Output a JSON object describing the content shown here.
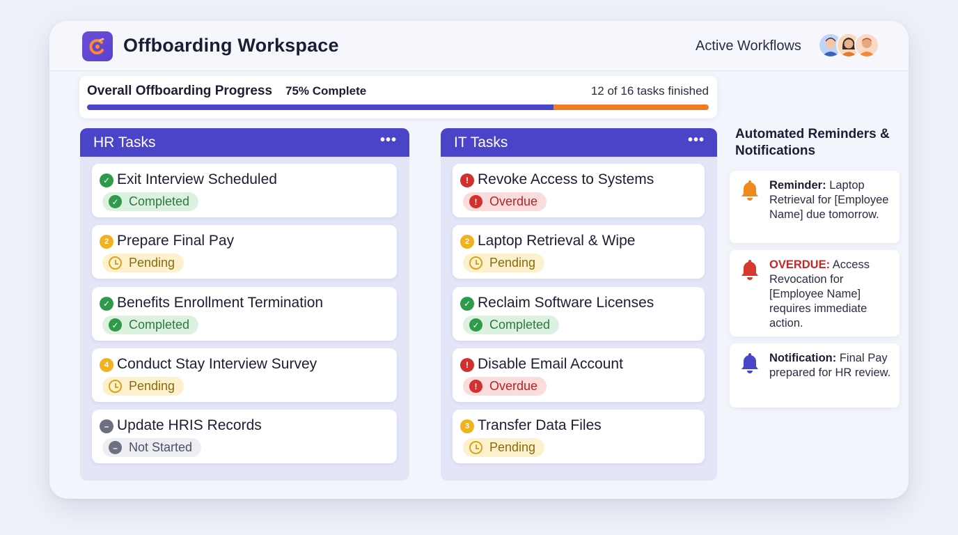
{
  "header": {
    "title": "Offboarding Workspace",
    "active_workflows_label": "Active Workflows",
    "avatars": [
      "avatar-1",
      "avatar-2",
      "avatar-3"
    ]
  },
  "progress": {
    "title": "Overall Offboarding Progress",
    "percent_label": "75% Complete",
    "count_label": "12 of 16 tasks finished",
    "fraction": 0.75
  },
  "columns": [
    {
      "title": "HR Tasks",
      "menu": "•••",
      "tasks": [
        {
          "name": "Exit Interview Scheduled",
          "status": "Completed",
          "icon": "check-icon",
          "marker": "✓"
        },
        {
          "name": "Prepare Final Pay",
          "status": "Pending",
          "icon": "step-2-icon",
          "marker": "2"
        },
        {
          "name": "Benefits Enrollment Termination",
          "status": "Completed",
          "icon": "check-icon",
          "marker": "✓"
        },
        {
          "name": "Conduct Stay Interview Survey",
          "status": "Pending",
          "icon": "step-4-icon",
          "marker": "4"
        },
        {
          "name": "Update HRIS Records",
          "status": "Not Started",
          "icon": "minus-icon",
          "marker": "–"
        }
      ]
    },
    {
      "title": "IT Tasks",
      "menu": "•••",
      "tasks": [
        {
          "name": "Revoke Access to Systems",
          "status": "Overdue",
          "icon": "alert-icon",
          "marker": "!"
        },
        {
          "name": "Laptop Retrieval & Wipe",
          "status": "Pending",
          "icon": "step-2-icon",
          "marker": "2"
        },
        {
          "name": "Reclaim Software Licenses",
          "status": "Completed",
          "icon": "check-icon",
          "marker": "✓"
        },
        {
          "name": "Disable Email Account",
          "status": "Overdue",
          "icon": "alert-icon",
          "marker": "!"
        },
        {
          "name": "Transfer Data Files",
          "status": "Pending",
          "icon": "step-3-icon",
          "marker": "3"
        }
      ]
    }
  ],
  "reminders": {
    "title": "Automated Reminders & Notifications",
    "items": [
      {
        "label": "Reminder:",
        "text": "Laptop Retrieval for [Employee Name] due tomorrow.",
        "bell_color": "#f08a1c"
      },
      {
        "label": "OVERDUE:",
        "text": "Access Revocation for [Employee Name] requires immediate action.",
        "bell_color": "#d63a2e"
      },
      {
        "label": "Notification:",
        "text": "Final Pay prepared for HR review.",
        "bell_color": "#4b44c9"
      }
    ]
  },
  "colors": {
    "accent": "#4b44c9",
    "progress_remaining": "#f17d22",
    "completed": "#2f9a4a",
    "pending": "#f2b11f",
    "overdue": "#d22f2f",
    "not_started": "#6c7080"
  }
}
